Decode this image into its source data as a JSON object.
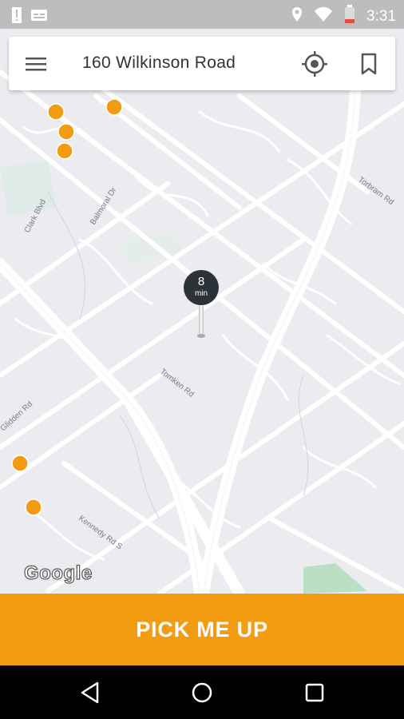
{
  "status_bar": {
    "time": "3:31",
    "icons": [
      "alert-icon",
      "caption-icon",
      "location-icon",
      "wifi-icon",
      "battery-icon"
    ]
  },
  "search": {
    "address": "160 Wilkinson Road",
    "menu_icon": "hamburger-menu-icon",
    "locate_icon": "my-location-icon",
    "bookmark_icon": "bookmark-icon"
  },
  "map": {
    "street_labels": [
      "Balmoral Dr",
      "Clark Blvd",
      "Tomken Rd",
      "Glidden Rd",
      "Kennedy Rd S",
      "Torbram Rd"
    ],
    "attribution": "Google",
    "eta": {
      "value": "8",
      "unit": "min"
    }
  },
  "primary_action": {
    "label": "PICK ME UP",
    "color": "#f39c12"
  },
  "nav_bar": {
    "icons": [
      "back-icon",
      "home-icon",
      "recents-icon"
    ]
  }
}
